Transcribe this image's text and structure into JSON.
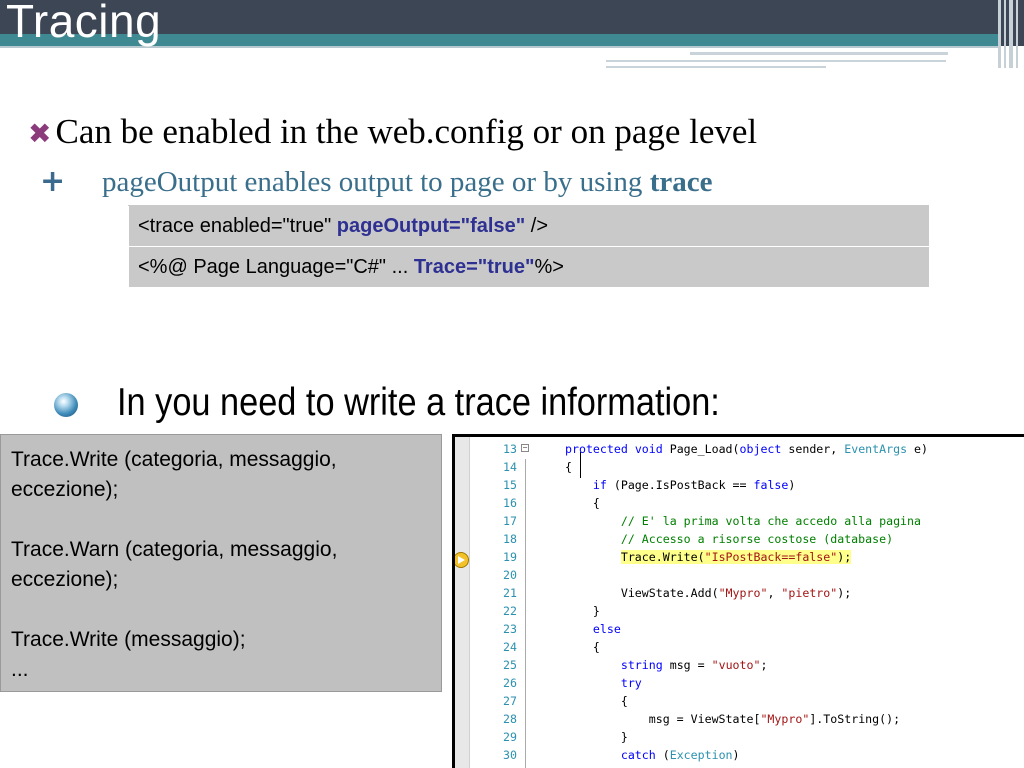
{
  "slide": {
    "title": "Tracing"
  },
  "bullets": {
    "first": "Can be enabled in the web.config or on page level",
    "second_prefix": "pageOutput enables output to page or by using ",
    "second_bold": "trace"
  },
  "config_table": {
    "row1_prefix": "<trace enabled=\"true\" ",
    "row1_highlight": "pageOutput=\"false\"",
    "row1_suffix": " />",
    "row2_prefix": "<%@ Page Language=\"C#\" ... ",
    "row2_highlight": "Trace=\"true\"",
    "row2_suffix": "%>"
  },
  "trace_section": {
    "heading": "In you need to write a trace information:",
    "api_lines": [
      "Trace.Write (categoria, messaggio,",
      "eccezione);",
      "",
      "Trace.Warn (categoria, messaggio,",
      "eccezione);",
      "",
      "Trace.Write (messaggio);",
      "..."
    ]
  },
  "code_editor": {
    "line_numbers": [
      "13",
      "14",
      "15",
      "16",
      "17",
      "18",
      "19",
      "20",
      "21",
      "22",
      "23",
      "24",
      "25",
      "26",
      "27",
      "28",
      "29",
      "30"
    ],
    "colors": {
      "keyword": "#0000ff",
      "type": "#2b91af",
      "string": "#a31515",
      "comment": "#008000",
      "highlight": "#ffff8c"
    }
  },
  "colors": {
    "title_bar": "#3d4654",
    "title_stripe": "#3f8a92",
    "bullet_x": "#8b3a7b",
    "sub_bullet": "#3a6f8c",
    "table_bg": "#c9c9c9",
    "table_highlight": "#2e3192"
  }
}
